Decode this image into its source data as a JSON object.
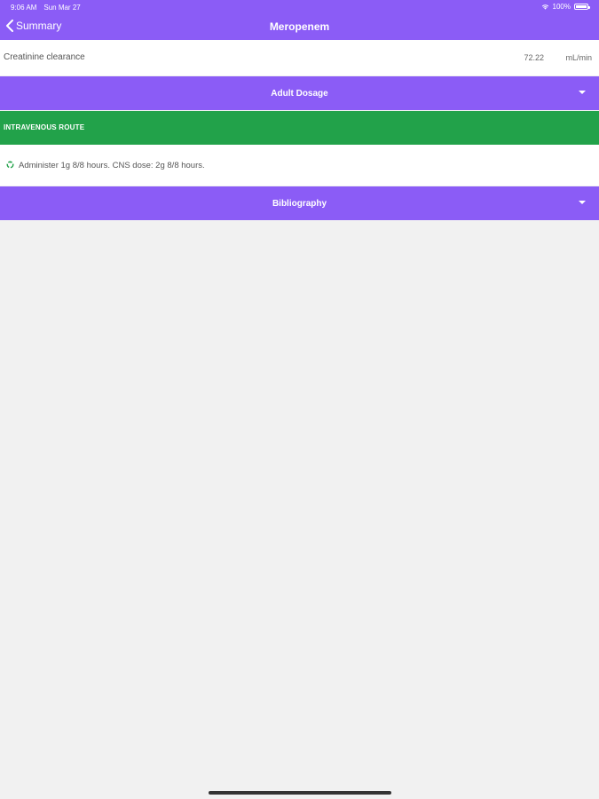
{
  "status_bar": {
    "time": "9:06 AM",
    "date": "Sun Mar 27",
    "battery": "100%"
  },
  "nav": {
    "back_label": "Summary",
    "title": "Meropenem"
  },
  "creatinine": {
    "label": "Creatinine clearance",
    "value": "72.22",
    "unit": "mL/min"
  },
  "sections": {
    "adult_dosage": "Adult Dosage",
    "route": "INTRAVENOUS ROUTE",
    "dose_text": "Administer 1g 8/8 hours. CNS dose: 2g 8/8 hours.",
    "bibliography": "Bibliography"
  },
  "colors": {
    "primary_purple": "#8b5cf6",
    "route_green": "#22a24a",
    "background": "#f1f1f1"
  },
  "icons": [
    "back-chevron-icon",
    "wifi-icon",
    "battery-icon",
    "chevron-down-icon",
    "recycle-bullet-icon"
  ]
}
